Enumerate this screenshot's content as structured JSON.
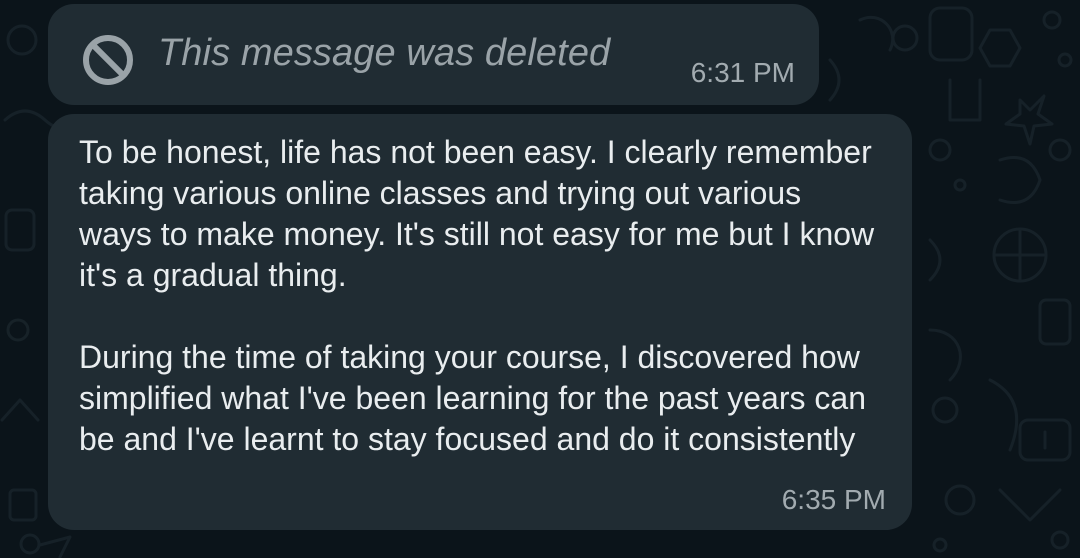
{
  "colors": {
    "chat_background": "#0b141a",
    "bubble_background": "#202c33",
    "message_text": "#e9edef",
    "meta_text": "#a2abb0"
  },
  "messages": [
    {
      "type": "deleted",
      "icon": "prohibited-icon",
      "text": "This message was deleted",
      "time": "6:31 PM"
    },
    {
      "type": "text",
      "paragraphs": [
        "To be honest, life has not been easy. I clearly remember taking various online classes and trying out various ways to make money. It's still not easy for me but I know it's a gradual thing.",
        "During the time of taking your course, I discovered how simplified what I've been learning for the past years can be and I've learnt to stay focused and do it consistently"
      ],
      "time": "6:35 PM"
    }
  ]
}
